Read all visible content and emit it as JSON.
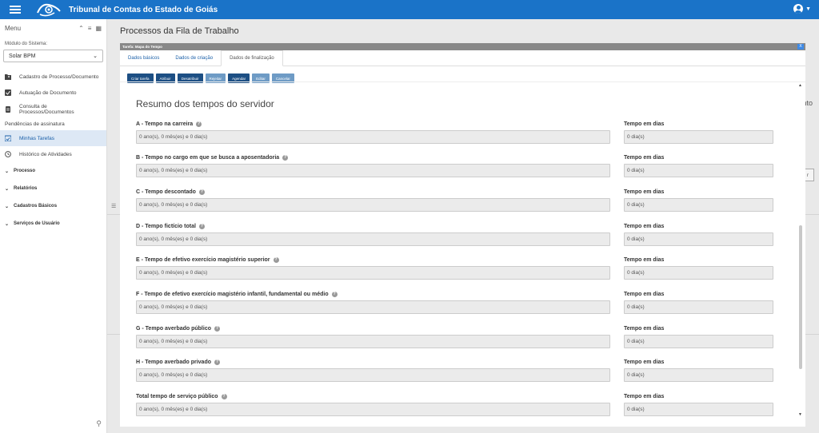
{
  "app": {
    "title": "Tribunal de Contas do Estado de Goiás"
  },
  "sidebar": {
    "menu_label": "Menu",
    "module_label": "Módulo do Sistema:",
    "module_value": "Solar BPM",
    "items": [
      {
        "label": "Cadastro de Processo/Documento",
        "icon": "folder-add-icon"
      },
      {
        "label": "Autuação de Documento",
        "icon": "checkbox-icon"
      },
      {
        "label": "Consulta de Processos/Documentos",
        "icon": "document-icon"
      }
    ],
    "pending_section": "Pendências de assinatura",
    "task_items": [
      {
        "label": "Minhas Tarefas",
        "icon": "calendar-check-icon",
        "active": true
      },
      {
        "label": "Histórico de Atividades",
        "icon": "clock-icon",
        "active": false
      }
    ],
    "groups": [
      "Processo",
      "Relatórios",
      "Cadastros Básicos",
      "Serviços de Usuário"
    ]
  },
  "page": {
    "title": "Processos da Fila de Trabalho",
    "bg_label": "nto",
    "bg_button": "r"
  },
  "modal": {
    "title": "Tarefa: Mapa do Tempo",
    "close": "X",
    "tabs": [
      {
        "label": "Dados básicos",
        "active": false
      },
      {
        "label": "Dados de criação",
        "active": false
      },
      {
        "label": "Dados de finalização",
        "active": true
      }
    ],
    "actions": [
      {
        "label": "Criar tarefa",
        "disabled": false
      },
      {
        "label": "Atribuir",
        "disabled": false
      },
      {
        "label": "Desatribuir",
        "disabled": false
      },
      {
        "label": "Rejeitar",
        "disabled": true
      },
      {
        "label": "Agendar",
        "disabled": false
      },
      {
        "label": "Editar",
        "disabled": true
      },
      {
        "label": "Cancelar",
        "disabled": true
      }
    ],
    "section_title": "Resumo dos tempos do servidor",
    "days_label": "Tempo em dias",
    "fields": [
      {
        "label": "A - Tempo na carreira",
        "value": "0 ano(s), 0 mês(es) e 0 dia(s)",
        "days": "0 dia(s)"
      },
      {
        "label": "B - Tempo no cargo em que se busca a aposentadoria",
        "value": "0 ano(s), 0 mês(es) e 0 dia(s)",
        "days": "0 dia(s)"
      },
      {
        "label": "C - Tempo descontado",
        "value": "0 ano(s), 0 mês(es) e 0 dia(s)",
        "days": "0 dia(s)"
      },
      {
        "label": "D - Tempo fictício total",
        "value": "0 ano(s), 0 mês(es) e 0 dia(s)",
        "days": "0 dia(s)"
      },
      {
        "label": "E - Tempo de efetivo exercício magistério superior",
        "value": "0 ano(s), 0 mês(es) e 0 dia(s)",
        "days": "0 dia(s)"
      },
      {
        "label": "F - Tempo de efetivo exercício magistério infantil, fundamental ou médio",
        "value": "0 ano(s), 0 mês(es) e 0 dia(s)",
        "days": "0 dia(s)"
      },
      {
        "label": "G - Tempo averbado público",
        "value": "0 ano(s), 0 mês(es) e 0 dia(s)",
        "days": "0 dia(s)"
      },
      {
        "label": "H - Tempo averbado privado",
        "value": "0 ano(s), 0 mês(es) e 0 dia(s)",
        "days": "0 dia(s)"
      },
      {
        "label": "Total tempo de serviço público",
        "value": "0 ano(s), 0 mês(es) e 0 dia(s)",
        "days": "0 dia(s)"
      }
    ]
  },
  "colors": {
    "brand": "#1a73c8",
    "button": "#1d4f84",
    "button_disabled": "#6e9bc5"
  }
}
